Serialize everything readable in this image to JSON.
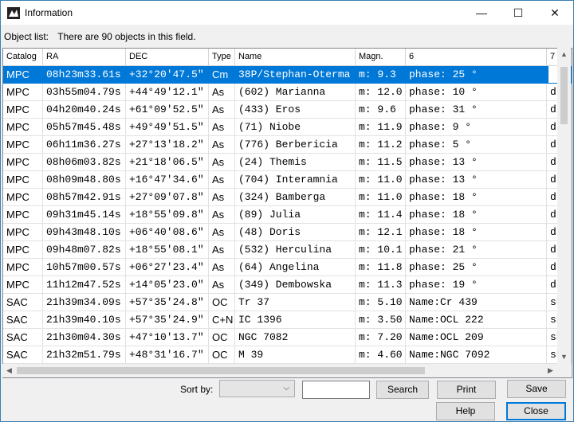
{
  "window": {
    "title": "Information"
  },
  "object_list": {
    "label": "Object list:",
    "info": "There are 90 objects in this field."
  },
  "columns": [
    "Catalog",
    "RA",
    "DEC",
    "Type",
    "Name",
    "Magn.",
    "6",
    "7"
  ],
  "rows": [
    {
      "catalog": "MPC",
      "ra": "08h23m33.61s",
      "dec": "+32°20'47.5\"",
      "type": "Cm",
      "name": "38P/Stephan-Oterma",
      "mag": "m: 9.3",
      "c6": "phase: 25 °",
      "c7": "d:",
      "selected": true
    },
    {
      "catalog": "MPC",
      "ra": "03h55m04.79s",
      "dec": "+44°49'12.1\"",
      "type": "As",
      "name": "(602) Marianna",
      "mag": "m: 12.0",
      "c6": "phase: 10 °",
      "c7": "d:"
    },
    {
      "catalog": "MPC",
      "ra": "04h20m40.24s",
      "dec": "+61°09'52.5\"",
      "type": "As",
      "name": "(433) Eros",
      "mag": "m: 9.6",
      "c6": "phase: 31 °",
      "c7": "d:"
    },
    {
      "catalog": "MPC",
      "ra": "05h57m45.48s",
      "dec": "+49°49'51.5\"",
      "type": "As",
      "name": "(71) Niobe",
      "mag": "m: 11.9",
      "c6": "phase: 9 °",
      "c7": "d:"
    },
    {
      "catalog": "MPC",
      "ra": "06h11m36.27s",
      "dec": "+27°13'18.2\"",
      "type": "As",
      "name": "(776) Berbericia",
      "mag": "m: 11.2",
      "c6": "phase: 5 °",
      "c7": "d:"
    },
    {
      "catalog": "MPC",
      "ra": "08h06m03.82s",
      "dec": "+21°18'06.5\"",
      "type": "As",
      "name": "(24) Themis",
      "mag": "m: 11.5",
      "c6": "phase: 13 °",
      "c7": "d:"
    },
    {
      "catalog": "MPC",
      "ra": "08h09m48.80s",
      "dec": "+16°47'34.6\"",
      "type": "As",
      "name": "(704) Interamnia",
      "mag": "m: 11.0",
      "c6": "phase: 13 °",
      "c7": "d:"
    },
    {
      "catalog": "MPC",
      "ra": "08h57m42.91s",
      "dec": "+27°09'07.8\"",
      "type": "As",
      "name": "(324) Bamberga",
      "mag": "m: 11.0",
      "c6": "phase: 18 °",
      "c7": "d:"
    },
    {
      "catalog": "MPC",
      "ra": "09h31m45.14s",
      "dec": "+18°55'09.8\"",
      "type": "As",
      "name": "(89) Julia",
      "mag": "m: 11.4",
      "c6": "phase: 18 °",
      "c7": "d:"
    },
    {
      "catalog": "MPC",
      "ra": "09h43m48.10s",
      "dec": "+06°40'08.6\"",
      "type": "As",
      "name": "(48) Doris",
      "mag": "m: 12.1",
      "c6": "phase: 18 °",
      "c7": "d:"
    },
    {
      "catalog": "MPC",
      "ra": "09h48m07.82s",
      "dec": "+18°55'08.1\"",
      "type": "As",
      "name": "(532) Herculina",
      "mag": "m: 10.1",
      "c6": "phase: 21 °",
      "c7": "d:"
    },
    {
      "catalog": "MPC",
      "ra": "10h57m00.57s",
      "dec": "+06°27'23.4\"",
      "type": "As",
      "name": "(64) Angelina",
      "mag": "m: 11.8",
      "c6": "phase: 25 °",
      "c7": "d:"
    },
    {
      "catalog": "MPC",
      "ra": "11h12m47.52s",
      "dec": "+14°05'23.0\"",
      "type": "As",
      "name": "(349) Dembowska",
      "mag": "m: 11.3",
      "c6": "phase: 19 °",
      "c7": "d:"
    },
    {
      "catalog": "SAC",
      "ra": "21h39m34.09s",
      "dec": "+57°35'24.8\"",
      "type": "OC",
      "name": "Tr 37",
      "mag": "m: 5.10",
      "c6": "Name:Cr 439",
      "c7": "sh"
    },
    {
      "catalog": "SAC",
      "ra": "21h39m40.10s",
      "dec": "+57°35'24.9\"",
      "type": "C+N",
      "name": "IC 1396",
      "mag": "m: 3.50",
      "c6": "Name:OCL 222",
      "c7": "sh"
    },
    {
      "catalog": "SAC",
      "ra": "21h30m04.30s",
      "dec": "+47°10'13.7\"",
      "type": "OC",
      "name": "NGC 7082",
      "mag": "m: 7.20",
      "c6": "Name:OCL 209",
      "c7": "sh"
    },
    {
      "catalog": "SAC",
      "ra": "21h32m51.79s",
      "dec": "+48°31'16.7\"",
      "type": "OC",
      "name": "M 39",
      "mag": "m: 4.60",
      "c6": "Name:NGC 7092",
      "c7": "sh"
    }
  ],
  "controls": {
    "sort_label": "Sort by:",
    "sort_value": "",
    "search_value": "",
    "search_button": "Search",
    "print_button": "Print",
    "save_button": "Save",
    "help_button": "Help",
    "close_button": "Close"
  },
  "icons": {
    "minimize": "minimize-icon",
    "maximize": "maximize-icon",
    "close": "close-icon",
    "app": "app-icon"
  },
  "colors": {
    "selection": "#0078d7",
    "window_border": "#3c7fb1"
  }
}
